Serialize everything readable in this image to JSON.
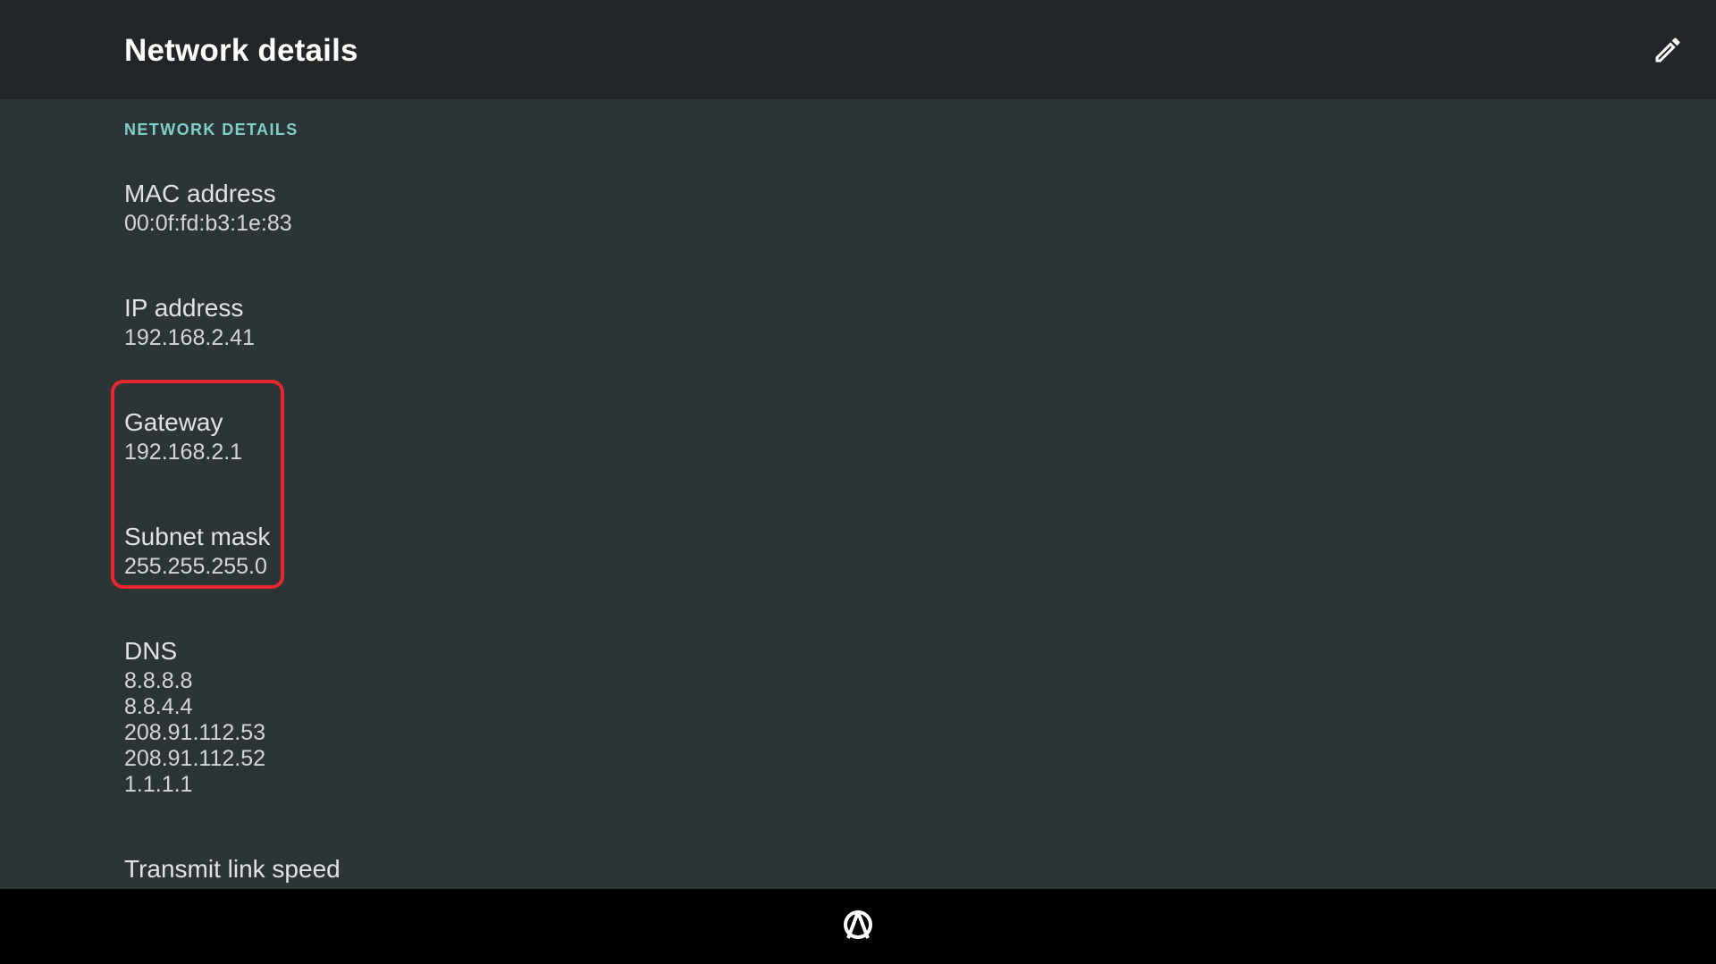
{
  "header": {
    "title": "Network details",
    "edit_icon": "pencil-icon"
  },
  "section": {
    "header": "NETWORK DETAILS"
  },
  "details": {
    "mac": {
      "label": "MAC address",
      "value": "00:0f:fd:b3:1e:83"
    },
    "ip": {
      "label": "IP address",
      "value": "192.168.2.41"
    },
    "gateway": {
      "label": "Gateway",
      "value": "192.168.2.1"
    },
    "subnet": {
      "label": "Subnet mask",
      "value": "255.255.255.0"
    },
    "dns": {
      "label": "DNS",
      "values": [
        "8.8.8.8",
        "8.8.4.4",
        "208.91.112.53",
        "208.91.112.52",
        "1.1.1.1"
      ]
    },
    "transmit": {
      "label": "Transmit link speed"
    }
  },
  "navbar": {
    "home_icon": "launcher-home-icon"
  },
  "colors": {
    "accent": "#7fcfc9",
    "highlight": "#e8262f",
    "header_bg": "#222629",
    "content_bg": "#2d3436",
    "navbar_bg": "#000000"
  }
}
